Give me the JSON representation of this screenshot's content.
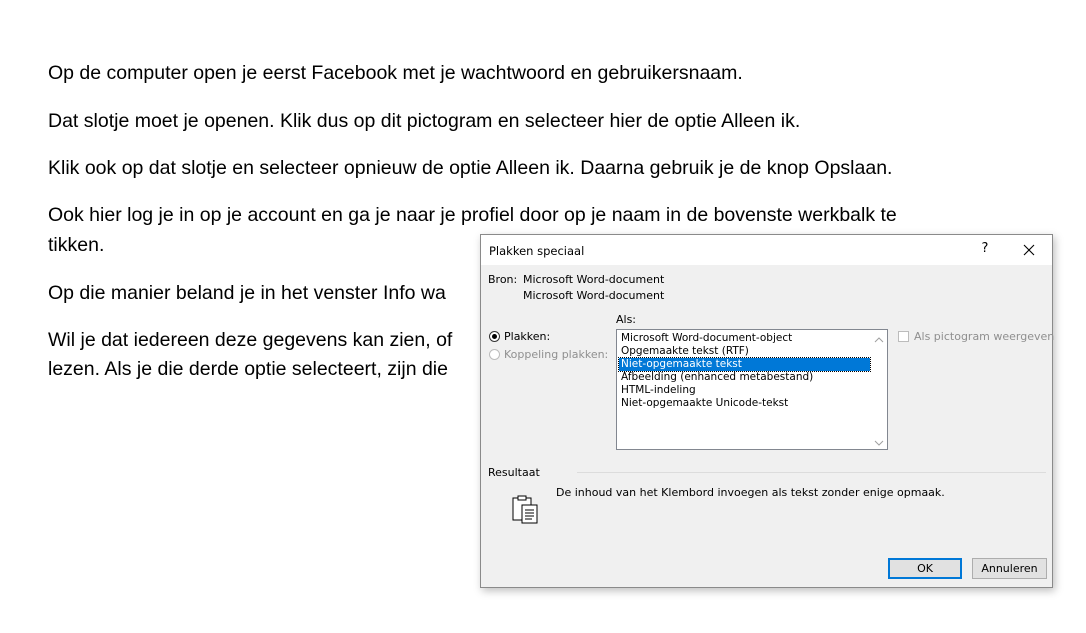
{
  "document": {
    "paragraphs": [
      "Op de computer open je eerst Facebook met je wachtwoord en gebruikersnaam.",
      "Dat slotje moet je openen. Klik dus op dit pictogram en selecteer hier de optie Alleen ik.",
      "Klik ook op dat slotje en selecteer opnieuw de optie Alleen ik. Daarna gebruik je de knop Opslaan.",
      "Ook hier log je in op je account en ga je naar je profiel door op je naam in de bovenste werkbalk te",
      "tikken.",
      "Op die manier beland je in het venster Info wa",
      "Wil je dat iedereen deze gegevens kan zien, of",
      "lezen. Als je die derde optie selecteert, zijn die"
    ]
  },
  "dialog": {
    "title": "Plakken speciaal",
    "help_label": "?",
    "source_label": "Bron:",
    "source_line1": "Microsoft Word-document",
    "source_line2": "Microsoft Word-document",
    "as_label": "Als:",
    "paste_label": "Plakken:",
    "paste_link_label": "Koppeling plakken:",
    "formats": [
      "Microsoft Word-document-object",
      "Opgemaakte tekst (RTF)",
      "Niet-opgemaakte tekst",
      "Afbeelding (enhanced metabestand)",
      "HTML-indeling",
      "Niet-opgemaakte Unicode-tekst"
    ],
    "selected_format": "Niet-opgemaakte tekst",
    "display_as_icon_label": "Als pictogram weergeven",
    "result_label": "Resultaat",
    "result_text": "De inhoud van het Klembord invoegen als tekst zonder enige opmaak.",
    "ok_label": "OK",
    "cancel_label": "Annuleren",
    "accent_color": "#0078d7",
    "icons": {
      "close": "close-icon",
      "clipboard": "clipboard-icon"
    }
  }
}
